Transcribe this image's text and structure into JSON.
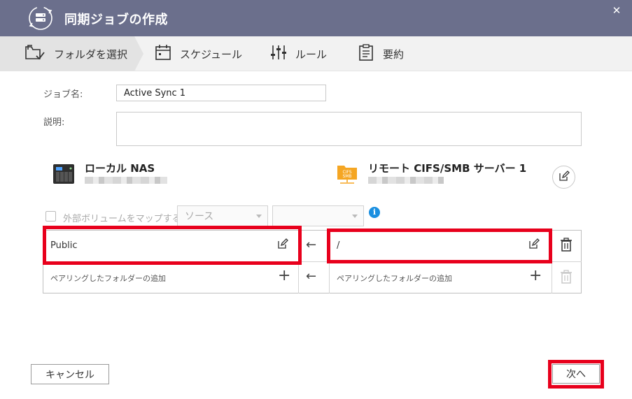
{
  "window": {
    "title": "同期ジョブの作成",
    "close_glyph": "✕"
  },
  "steps": [
    {
      "label": "フォルダを選択",
      "icon": "folder-check-icon"
    },
    {
      "label": "スケジュール",
      "icon": "calendar-icon"
    },
    {
      "label": "ルール",
      "icon": "sliders-icon"
    },
    {
      "label": "要約",
      "icon": "clipboard-icon"
    }
  ],
  "form": {
    "job_name_label": "ジョブ名:",
    "job_name_value": "Active Sync 1",
    "description_label": "説明:",
    "description_value": ""
  },
  "devices": {
    "local_title": "ローカル NAS",
    "remote_title": "リモート CIFS/SMB サーバー 1",
    "remote_badge_line1": "CIFS",
    "remote_badge_line2": "SMB"
  },
  "options": {
    "map_volume_label": "外部ボリュームをマップする",
    "source_placeholder": "ソース",
    "target_placeholder": "",
    "info_glyph": "i"
  },
  "pairs": {
    "rows": [
      {
        "local": "Public",
        "remote": "/"
      }
    ],
    "add_local_label": "ペアリングしたフォルダーの追加",
    "add_remote_label": "ペアリングしたフォルダーの追加",
    "arrow_glyph": "←",
    "plus_glyph": "+"
  },
  "footer": {
    "cancel_label": "キャンセル",
    "next_label": "次へ"
  },
  "colors": {
    "titlebar": "#6b6f8c",
    "highlight": "#e8001c",
    "info": "#1a8fe0",
    "folder_orange": "#f5a623"
  }
}
